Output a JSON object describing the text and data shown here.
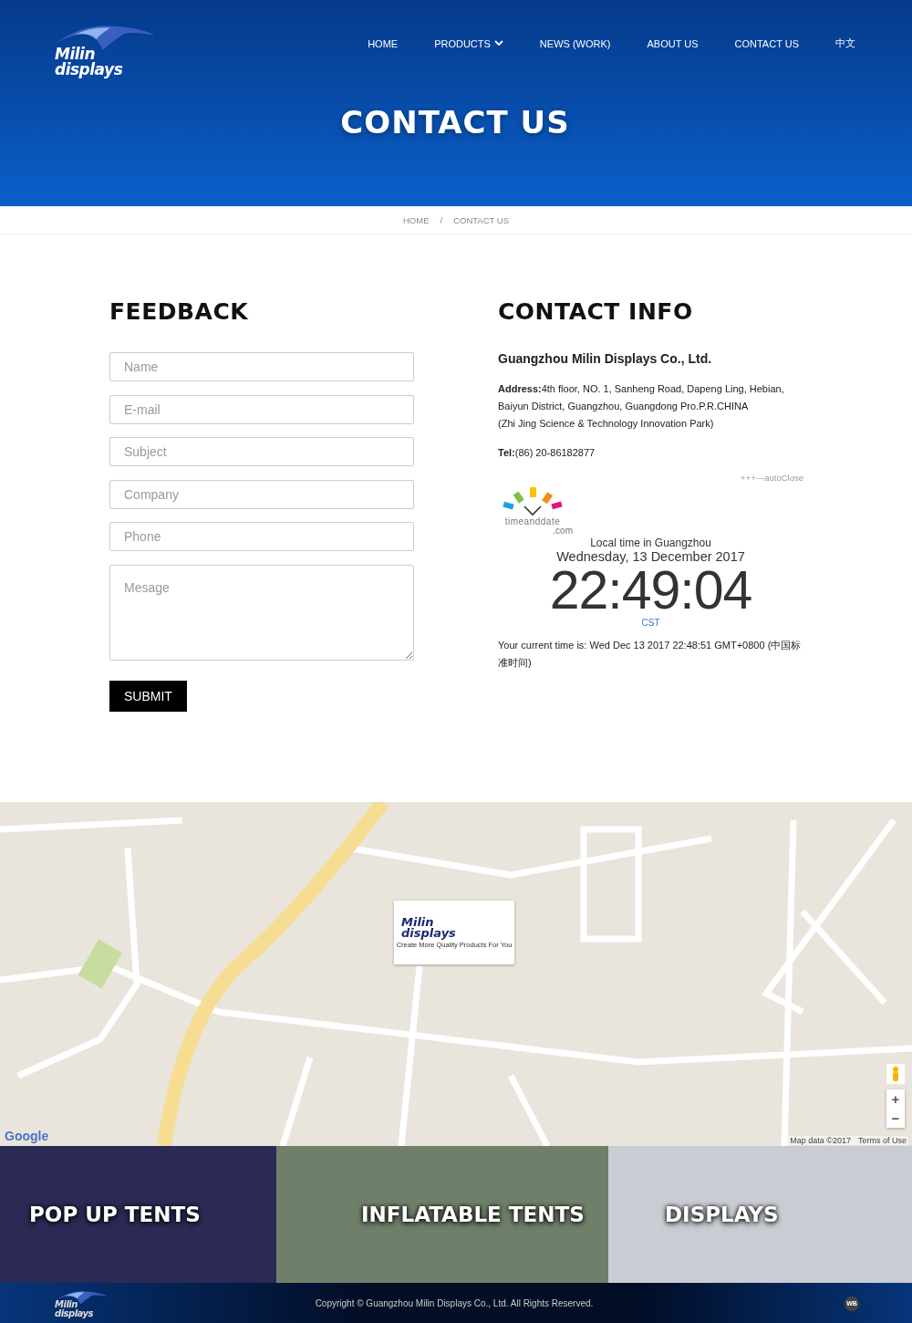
{
  "header": {
    "logo": {
      "line_1": "Milin",
      "line_2": "displays"
    },
    "nav": [
      {
        "label": "HOME",
        "has_caret": false
      },
      {
        "label": "PRODUCTS",
        "has_caret": true
      },
      {
        "label": "NEWS (WORK)",
        "has_caret": false
      },
      {
        "label": "ABOUT US",
        "has_caret": false
      },
      {
        "label": "CONTACT US",
        "has_caret": false
      },
      {
        "label": "中文",
        "has_caret": false
      }
    ],
    "title": "CONTACT US"
  },
  "breadcrumb": {
    "items": [
      "HOME",
      "CONTACT US"
    ],
    "separator": "/"
  },
  "feedback": {
    "title": "FEEDBACK",
    "fields": [
      {
        "kind": "input",
        "placeholder": "Name"
      },
      {
        "kind": "input",
        "placeholder": "E-mail"
      },
      {
        "kind": "input",
        "placeholder": "Subject"
      },
      {
        "kind": "input",
        "placeholder": "Company"
      },
      {
        "kind": "input",
        "placeholder": "Phone"
      },
      {
        "kind": "textarea",
        "placeholder": "Mesage"
      }
    ],
    "submit": "SUBMIT"
  },
  "contact_info": {
    "title": "CONTACT INFO",
    "company": "Guangzhou Milin Displays Co., Ltd.",
    "address_lines": [
      "**Address:**4th floor, NO. 1, Sanheng Road, Dapeng Ling, Hebian,",
      "Baiyun District, Guangzhou, Guangdong Pro.P.R.CHINA",
      "(Zhi Jing Science & Technology Innovation Park)"
    ],
    "tel": "**Tel:**(86) 20-86182877",
    "clock": {
      "auto_close": "+++---autoClose",
      "brand": "timeanddate",
      "brand_suffix": ".com",
      "location": "Local time in Guangzhou",
      "date": "Wednesday, 13 December 2017",
      "time": "22:49:04",
      "zone": "CST"
    },
    "current_time": "Your current time is: Wed Dec 13 2017 22:48:51 GMT+0800 (中国标准时间)"
  },
  "map": {
    "marker": {
      "line_1": "Milin",
      "line_2": "displays",
      "tagline": "Create More Quality Products For You"
    },
    "brand": "Google",
    "attribution": "Map data ©2017",
    "terms": "Terms of Use",
    "zoom_in": "+",
    "zoom_out": "−"
  },
  "categories": [
    {
      "title": "POP UP TENTS",
      "color": "#2a2a55"
    },
    {
      "title": "INFLATABLE TENTS",
      "color": "#6f7f6a"
    },
    {
      "title": "DISPLAYS",
      "color": "#c9ccd3"
    }
  ],
  "footer": {
    "logo": {
      "line_1": "Milin",
      "line_2": "displays"
    },
    "copyright": "Copyright © Guangzhou Milin Displays Co., Ltd. All Rights Reserved.",
    "badge": "WB"
  }
}
